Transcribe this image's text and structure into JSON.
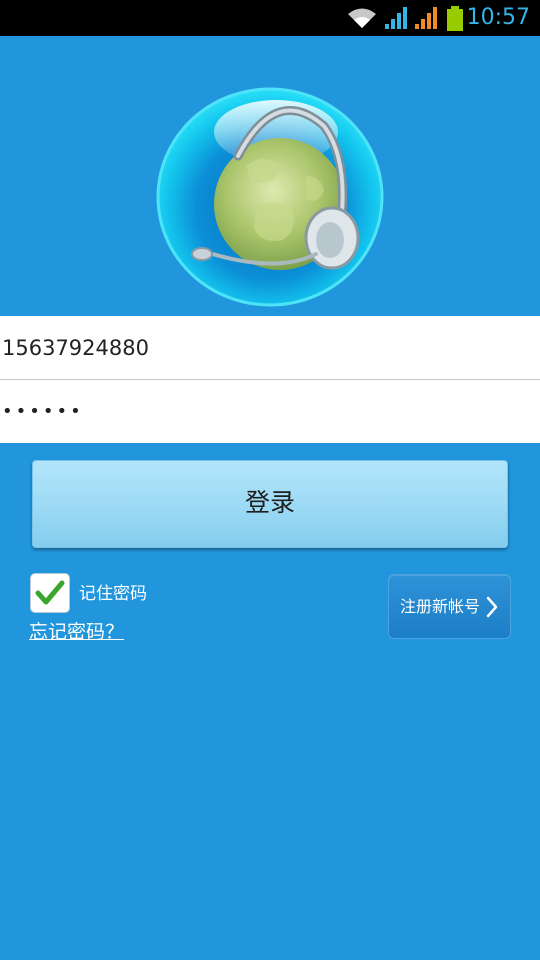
{
  "status_bar": {
    "time": "10:57",
    "icons": [
      "wifi-icon",
      "signal-icon",
      "signal-icon",
      "battery-icon"
    ]
  },
  "logo": {
    "icon": "globe-headset-logo"
  },
  "login_form": {
    "username_value": "15637924880",
    "password_value": "123456",
    "login_button_label": "登录",
    "remember_password_label": "记住密码",
    "remember_password_checked": true,
    "forgot_password_label": "忘记密码？",
    "register_button_label": "注册新帐号"
  },
  "colors": {
    "background": "#2196dc",
    "login_button": "#a0dcf6",
    "register_button": "#1c7ec6",
    "checkmark": "#3aa62e",
    "status_time": "#33b5e5"
  }
}
